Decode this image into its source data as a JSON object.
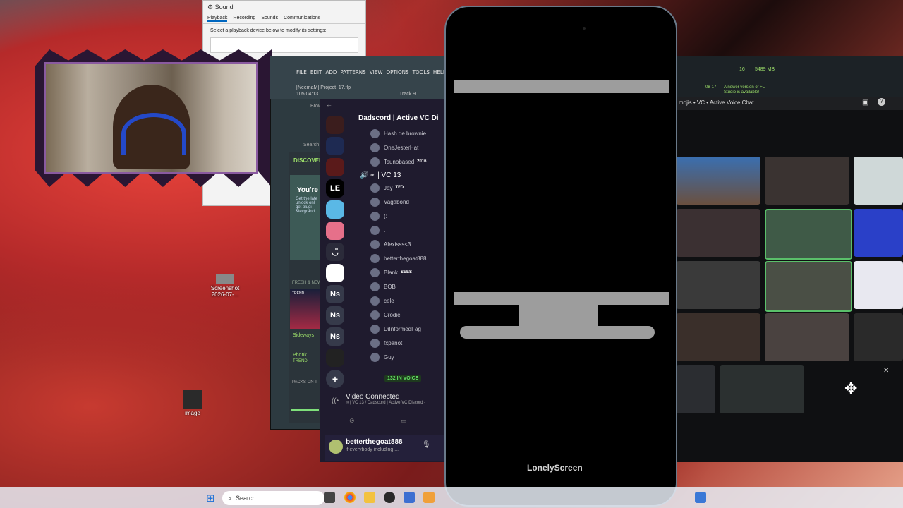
{
  "sound_dialog": {
    "title": "Sound",
    "tabs": [
      "Playback",
      "Recording",
      "Sounds",
      "Communications"
    ],
    "description": "Select a playback device below to modify its settings:"
  },
  "fl_studio": {
    "menu": [
      "FILE",
      "EDIT",
      "ADD",
      "PATTERNS",
      "VIEW",
      "OPTIONS",
      "TOOLS",
      "HELP"
    ],
    "user": "[NeemaM]",
    "project": "Project_17.flp",
    "time": "105:04:13",
    "track": "Track 9",
    "browser_label": "Brow",
    "search": "Search",
    "discover": "DISCOVER",
    "promo_title": "You're",
    "promo_lines": [
      "Get the late",
      "unlock onl",
      "get plugi",
      "Klevgrand"
    ],
    "fresh": "FRESH & NEW",
    "trend1": "TREND",
    "sideways": "Sideways",
    "phonk": "Phonk",
    "trend2": "TREND",
    "packs": "PACKS ON T",
    "cpu": "16",
    "ram": "5489 MB",
    "notice_date": "08-17",
    "notice": "A newer version of FL Studio is available!"
  },
  "discord": {
    "server": "Dadscord | Active VC Di",
    "guilds": [
      "",
      "",
      "",
      "LE",
      "",
      "",
      "◡̈",
      "",
      "Ns",
      "Ns",
      "Ns",
      "",
      ""
    ],
    "top_members": [
      "Hash de brownie",
      "OneJesterHat",
      "Tsunobased"
    ],
    "top_member_tag": "2016",
    "channel": "∞ | VC 13",
    "members": [
      {
        "name": "Jay",
        "tag": "TFD"
      },
      {
        "name": "Vagabond",
        "tag": ""
      },
      {
        "name": "(:",
        "tag": ""
      },
      {
        "name": ".",
        "tag": ""
      },
      {
        "name": "Alexisss<3",
        "tag": ""
      },
      {
        "name": "betterthegoat888",
        "tag": ""
      },
      {
        "name": "Blank",
        "tag": "SEES"
      },
      {
        "name": "BOB",
        "tag": ""
      },
      {
        "name": "cele",
        "tag": ""
      },
      {
        "name": "Crodie",
        "tag": ""
      },
      {
        "name": "DiInformedFag",
        "tag": ""
      },
      {
        "name": "fxpanot",
        "tag": ""
      },
      {
        "name": "Guy",
        "tag": ""
      }
    ],
    "in_voice": "132 IN VOICE",
    "connection": "Video Connected",
    "connection_sub": "∞ | VC 13 / Dadscord | Active VC Discord -",
    "user_name": "betterthegoat888",
    "user_status": "if everybody including ..."
  },
  "phone": {
    "watermark": "LonelyScreen"
  },
  "vc_window": {
    "title": "mojis • VC • Active Voice Chat"
  },
  "desktop": {
    "icon1": "Screenshot 2026-07-...",
    "icon2": "image"
  },
  "taskbar": {
    "search": "Search"
  }
}
